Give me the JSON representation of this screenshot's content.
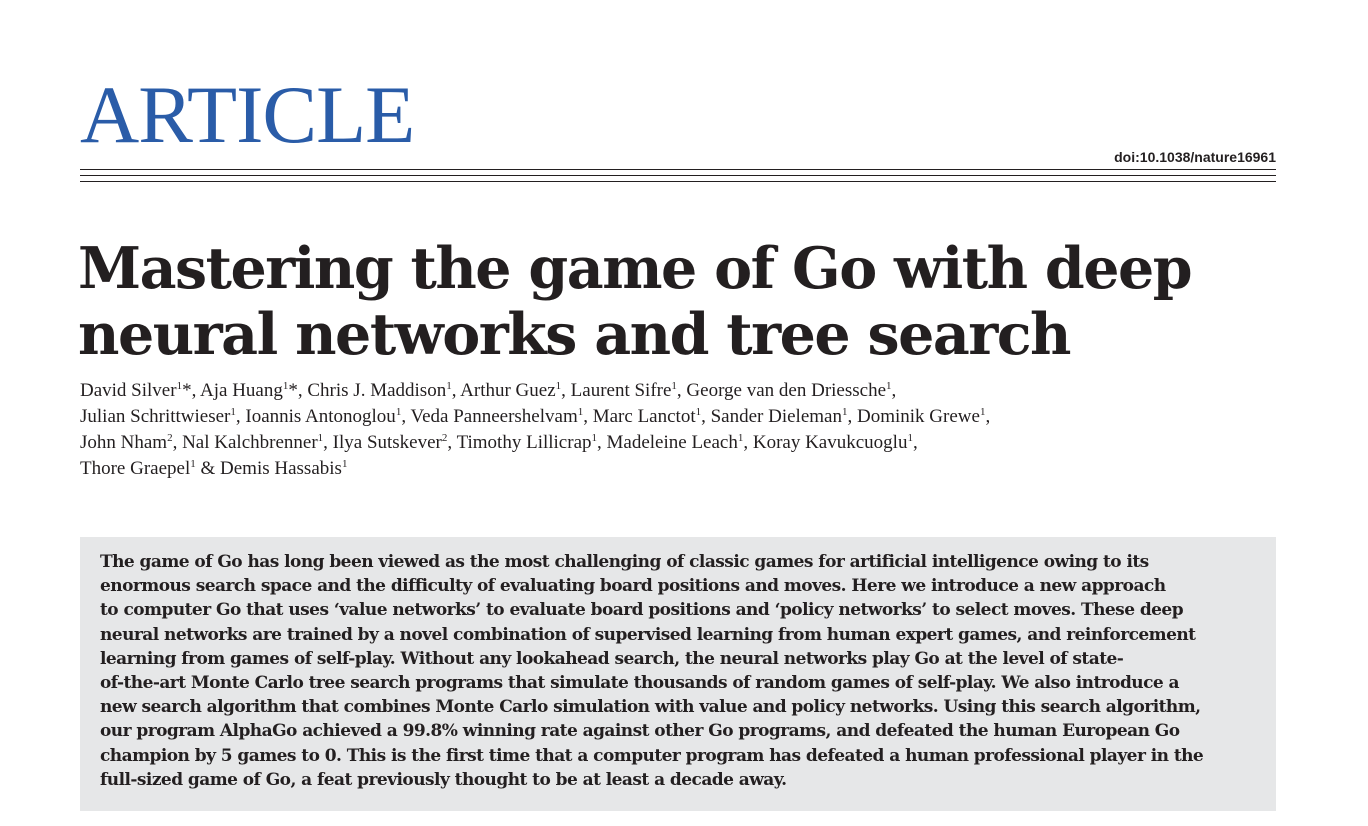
{
  "header": {
    "section_label": "ARTICLE",
    "doi": "doi:10.1038/nature16961",
    "accent_color": "#2a5ca8"
  },
  "article": {
    "title_lines": [
      "Mastering the game of Go with deep",
      "neural networks and tree search"
    ],
    "author_lines": [
      [
        {
          "name": "David Silver",
          "sup": "1",
          "after": "*, "
        },
        {
          "name": "Aja Huang",
          "sup": "1",
          "after": "*, "
        },
        {
          "name": "Chris J. Maddison",
          "sup": "1",
          "after": ", "
        },
        {
          "name": "Arthur Guez",
          "sup": "1",
          "after": ", "
        },
        {
          "name": "Laurent Sifre",
          "sup": "1",
          "after": ", "
        },
        {
          "name": "George van den Driessche",
          "sup": "1",
          "after": ","
        }
      ],
      [
        {
          "name": "Julian Schrittwieser",
          "sup": "1",
          "after": ", "
        },
        {
          "name": "Ioannis Antonoglou",
          "sup": "1",
          "after": ", "
        },
        {
          "name": "Veda Panneershelvam",
          "sup": "1",
          "after": ", "
        },
        {
          "name": "Marc Lanctot",
          "sup": "1",
          "after": ", "
        },
        {
          "name": "Sander Dieleman",
          "sup": "1",
          "after": ", "
        },
        {
          "name": "Dominik Grewe",
          "sup": "1",
          "after": ","
        }
      ],
      [
        {
          "name": "John Nham",
          "sup": "2",
          "after": ", "
        },
        {
          "name": "Nal Kalchbrenner",
          "sup": "1",
          "after": ", "
        },
        {
          "name": "Ilya Sutskever",
          "sup": "2",
          "after": ", "
        },
        {
          "name": "Timothy Lillicrap",
          "sup": "1",
          "after": ", "
        },
        {
          "name": "Madeleine Leach",
          "sup": "1",
          "after": ", "
        },
        {
          "name": "Koray Kavukcuoglu",
          "sup": "1",
          "after": ","
        }
      ],
      [
        {
          "name": "Thore Graepel",
          "sup": "1",
          "after": " & "
        },
        {
          "name": "Demis Hassabis",
          "sup": "1",
          "after": ""
        }
      ]
    ],
    "abstract_lines": [
      "The game of Go has long been viewed as the most challenging of classic games for artificial intelligence owing to its",
      "enormous search space and the difficulty of evaluating board positions and moves. Here we introduce a new approach",
      "to computer Go that uses ‘value networks’ to evaluate board positions and ‘policy networks’ to select moves. These deep",
      "neural networks are trained by a novel combination of supervised learning from human expert games, and reinforcement",
      "learning from games of self-play. Without any lookahead search, the neural networks play Go at the level of state-",
      "of-the-art Monte Carlo tree search programs that simulate thousands of random games of self-play. We also introduce a",
      "new search algorithm that combines Monte Carlo simulation with value and policy networks. Using this search algorithm,",
      "our program AlphaGo achieved a 99.8% winning rate against other Go programs, and defeated the human European Go",
      "champion by 5 games to 0. This is the first time that a computer program has defeated a human professional player in the",
      "full-sized game of Go, a feat previously thought to be at least a decade away."
    ]
  }
}
